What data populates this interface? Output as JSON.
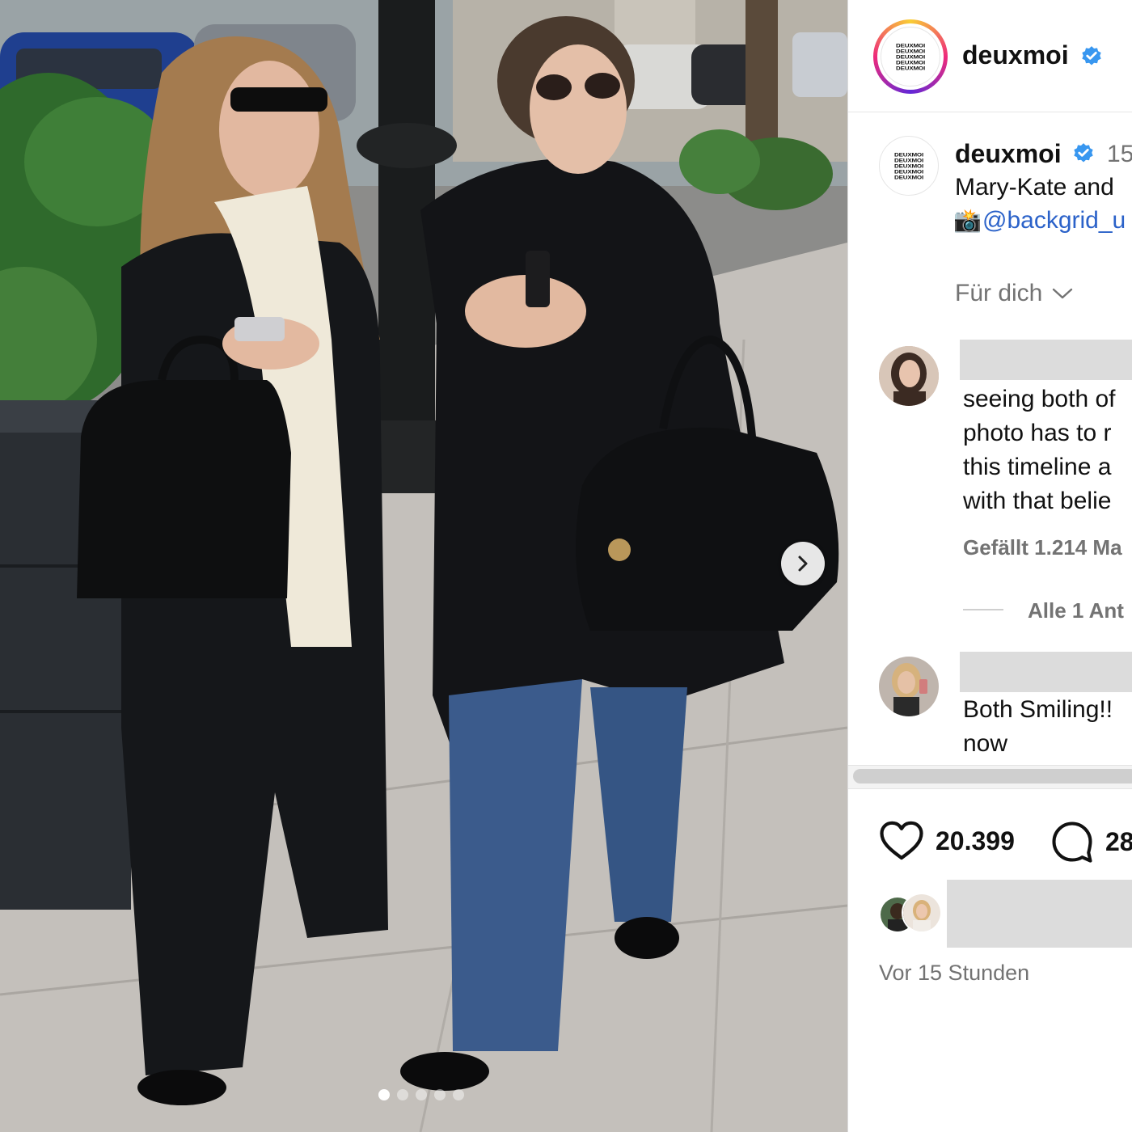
{
  "post": {
    "carousel": {
      "total_slides": 5,
      "active_slide": 1
    }
  },
  "header": {
    "username": "deuxmoi",
    "logo_lines": [
      "DEUXMOI",
      "DEUXMOI",
      "DEUXMOI",
      "DEUXMOI",
      "DEUXMOI"
    ]
  },
  "caption": {
    "username": "deuxmoi",
    "time": "15",
    "line1": "Mary-Kate and",
    "camera_emoji": "📸",
    "photo_credit": "@backgrid_u"
  },
  "filter": {
    "label": "Für dich",
    "icon": "chevron-down-icon"
  },
  "comments": [
    {
      "lines": [
        "seeing both of",
        "photo has to r",
        "this timeline a",
        "with that belie"
      ],
      "likes": "Gefällt 1.214 Ma",
      "replies": "Alle 1 Ant"
    },
    {
      "lines": [
        "Both Smiling!!",
        "now"
      ]
    }
  ],
  "actions": {
    "likes_count": "20.399",
    "comments_count": "28"
  },
  "timestamp": "Vor 15 Stunden",
  "colors": {
    "verified": "#3897f0",
    "link": "#2b62c9",
    "muted": "#737373"
  }
}
